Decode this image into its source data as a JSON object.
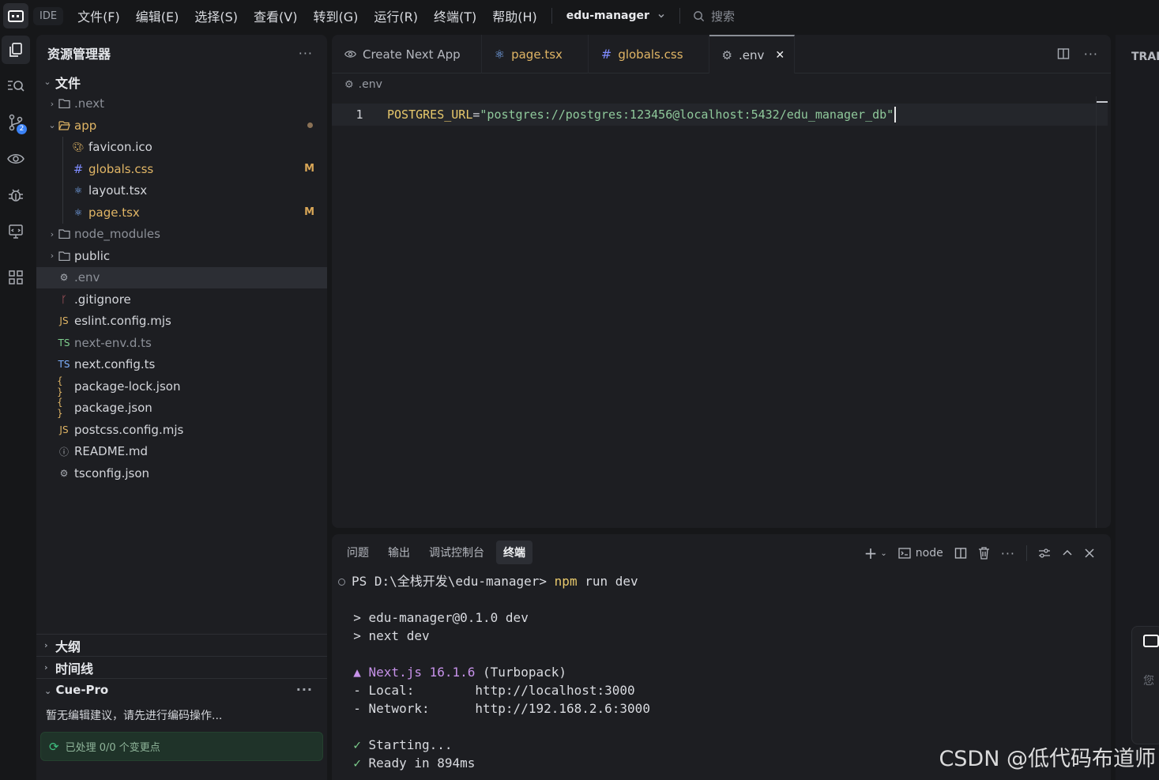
{
  "titlebar": {
    "ide": "IDE",
    "menu": [
      "文件(F)",
      "编辑(E)",
      "选择(S)",
      "查看(V)",
      "转到(G)",
      "运行(R)",
      "终端(T)",
      "帮助(H)"
    ],
    "project": "edu-manager",
    "search": "搜索"
  },
  "activity": {
    "scm_badge": "2"
  },
  "sidebar": {
    "title": "资源管理器",
    "root": "文件",
    "tree": [
      {
        "label": ".next",
        "dim": true
      },
      {
        "label": "app",
        "mod": true
      },
      {
        "label": "favicon.ico"
      },
      {
        "label": "globals.css",
        "status": "M"
      },
      {
        "label": "layout.tsx"
      },
      {
        "label": "page.tsx",
        "status": "M"
      },
      {
        "label": "node_modules",
        "dim": true
      },
      {
        "label": "public"
      },
      {
        "label": ".env",
        "dim": true
      },
      {
        "label": ".gitignore"
      },
      {
        "label": "eslint.config.mjs"
      },
      {
        "label": "next-env.d.ts",
        "dim": true
      },
      {
        "label": "next.config.ts"
      },
      {
        "label": "package-lock.json"
      },
      {
        "label": "package.json"
      },
      {
        "label": "postcss.config.mjs"
      },
      {
        "label": "README.md"
      },
      {
        "label": "tsconfig.json"
      }
    ],
    "outline": "大纲",
    "timeline": "时间线",
    "cue": "Cue-Pro",
    "cue_text": "暂无编辑建议，请先进行编码操作...",
    "cue_status": "已处理 0/0 个变更点"
  },
  "editor": {
    "tabs": [
      "Create Next App",
      "page.tsx",
      "globals.css",
      ".env"
    ],
    "breadcrumb": ".env",
    "line_number": "1",
    "code_key": "POSTGRES_URL",
    "code_eq": "=",
    "code_value": "\"postgres://postgres:123456@localhost:5432/edu_manager_db\""
  },
  "panel": {
    "tabs": [
      "问题",
      "输出",
      "调试控制台",
      "终端"
    ],
    "terminal_name": "node",
    "prompt": "PS D:\\全栈开发\\edu-manager> ",
    "cmd_npm": "npm",
    "cmd_rest": " run dev",
    "line_pkg": "> edu-manager@0.1.0 dev",
    "line_next": "> next dev",
    "next_tri": "▲ ",
    "next_ver": "Next.js 16.1.6",
    "next_tp": " (Turbopack)",
    "local_label": "- Local:        ",
    "local_url": "http://localhost:3000",
    "network_label": "- Network:      ",
    "network_url": "http://192.168.2.6:3000",
    "check": "✓",
    "starting": " Starting...",
    "ready": " Ready in 894ms"
  },
  "right": {
    "label": "TRAE",
    "card_text": "您"
  },
  "watermark": "CSDN @低代码布道师"
}
